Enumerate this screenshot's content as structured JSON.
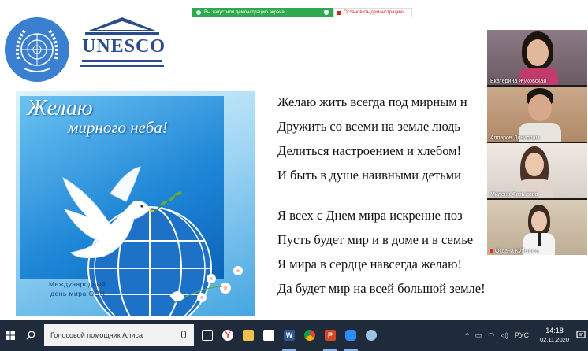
{
  "screen_share": {
    "status_text": "Вы запустили демонстрацию экрана",
    "stop_label": "Остановить демонстрацию"
  },
  "logos": {
    "unesco_text": "UNESCO"
  },
  "poster": {
    "title_line1": "Желаю",
    "title_line2": "мирного неба!",
    "bottom_line1": "Международный",
    "bottom_line2": "день мира ООН"
  },
  "poem": {
    "stanza1": [
      "Желаю жить всегда под мирным н",
      "Дружить со всеми на земле людь",
      "Делиться настроением и хлебом!",
      "И быть в душе наивными детьми"
    ],
    "stanza2": [
      "Я всех с Днем мира искренне поз",
      "Пусть будет мир и в доме и в семье",
      "Я мира в сердце навсегда желаю!",
      "Да будет мир на всей большой земле!"
    ]
  },
  "participants": [
    {
      "name": "Екатерина Жуковская"
    },
    {
      "name": "Аппаров Динислам"
    },
    {
      "name": "Милена Фазылова"
    },
    {
      "name": "Оксана Кубышка"
    }
  ],
  "taskbar": {
    "search_placeholder": "Голосовой помощник Алиса",
    "language": "РУС",
    "time": "14:18",
    "date": "02.11.2020",
    "app_icons": [
      {
        "name": "task-view-icon",
        "color": "#ffffff"
      },
      {
        "name": "yandex-browser-icon",
        "color": "#ff3333"
      },
      {
        "name": "file-explorer-icon",
        "color": "#f2c14e"
      },
      {
        "name": "mail-icon",
        "color": "#3a8ee6"
      },
      {
        "name": "word-icon",
        "color": "#2b5797"
      },
      {
        "name": "chrome-icon",
        "color": "#e8a33c"
      },
      {
        "name": "powerpoint-icon",
        "color": "#d24726"
      },
      {
        "name": "zoom-icon",
        "color": "#2d8cff"
      },
      {
        "name": "paint-icon",
        "color": "#9bc4e2"
      }
    ]
  }
}
